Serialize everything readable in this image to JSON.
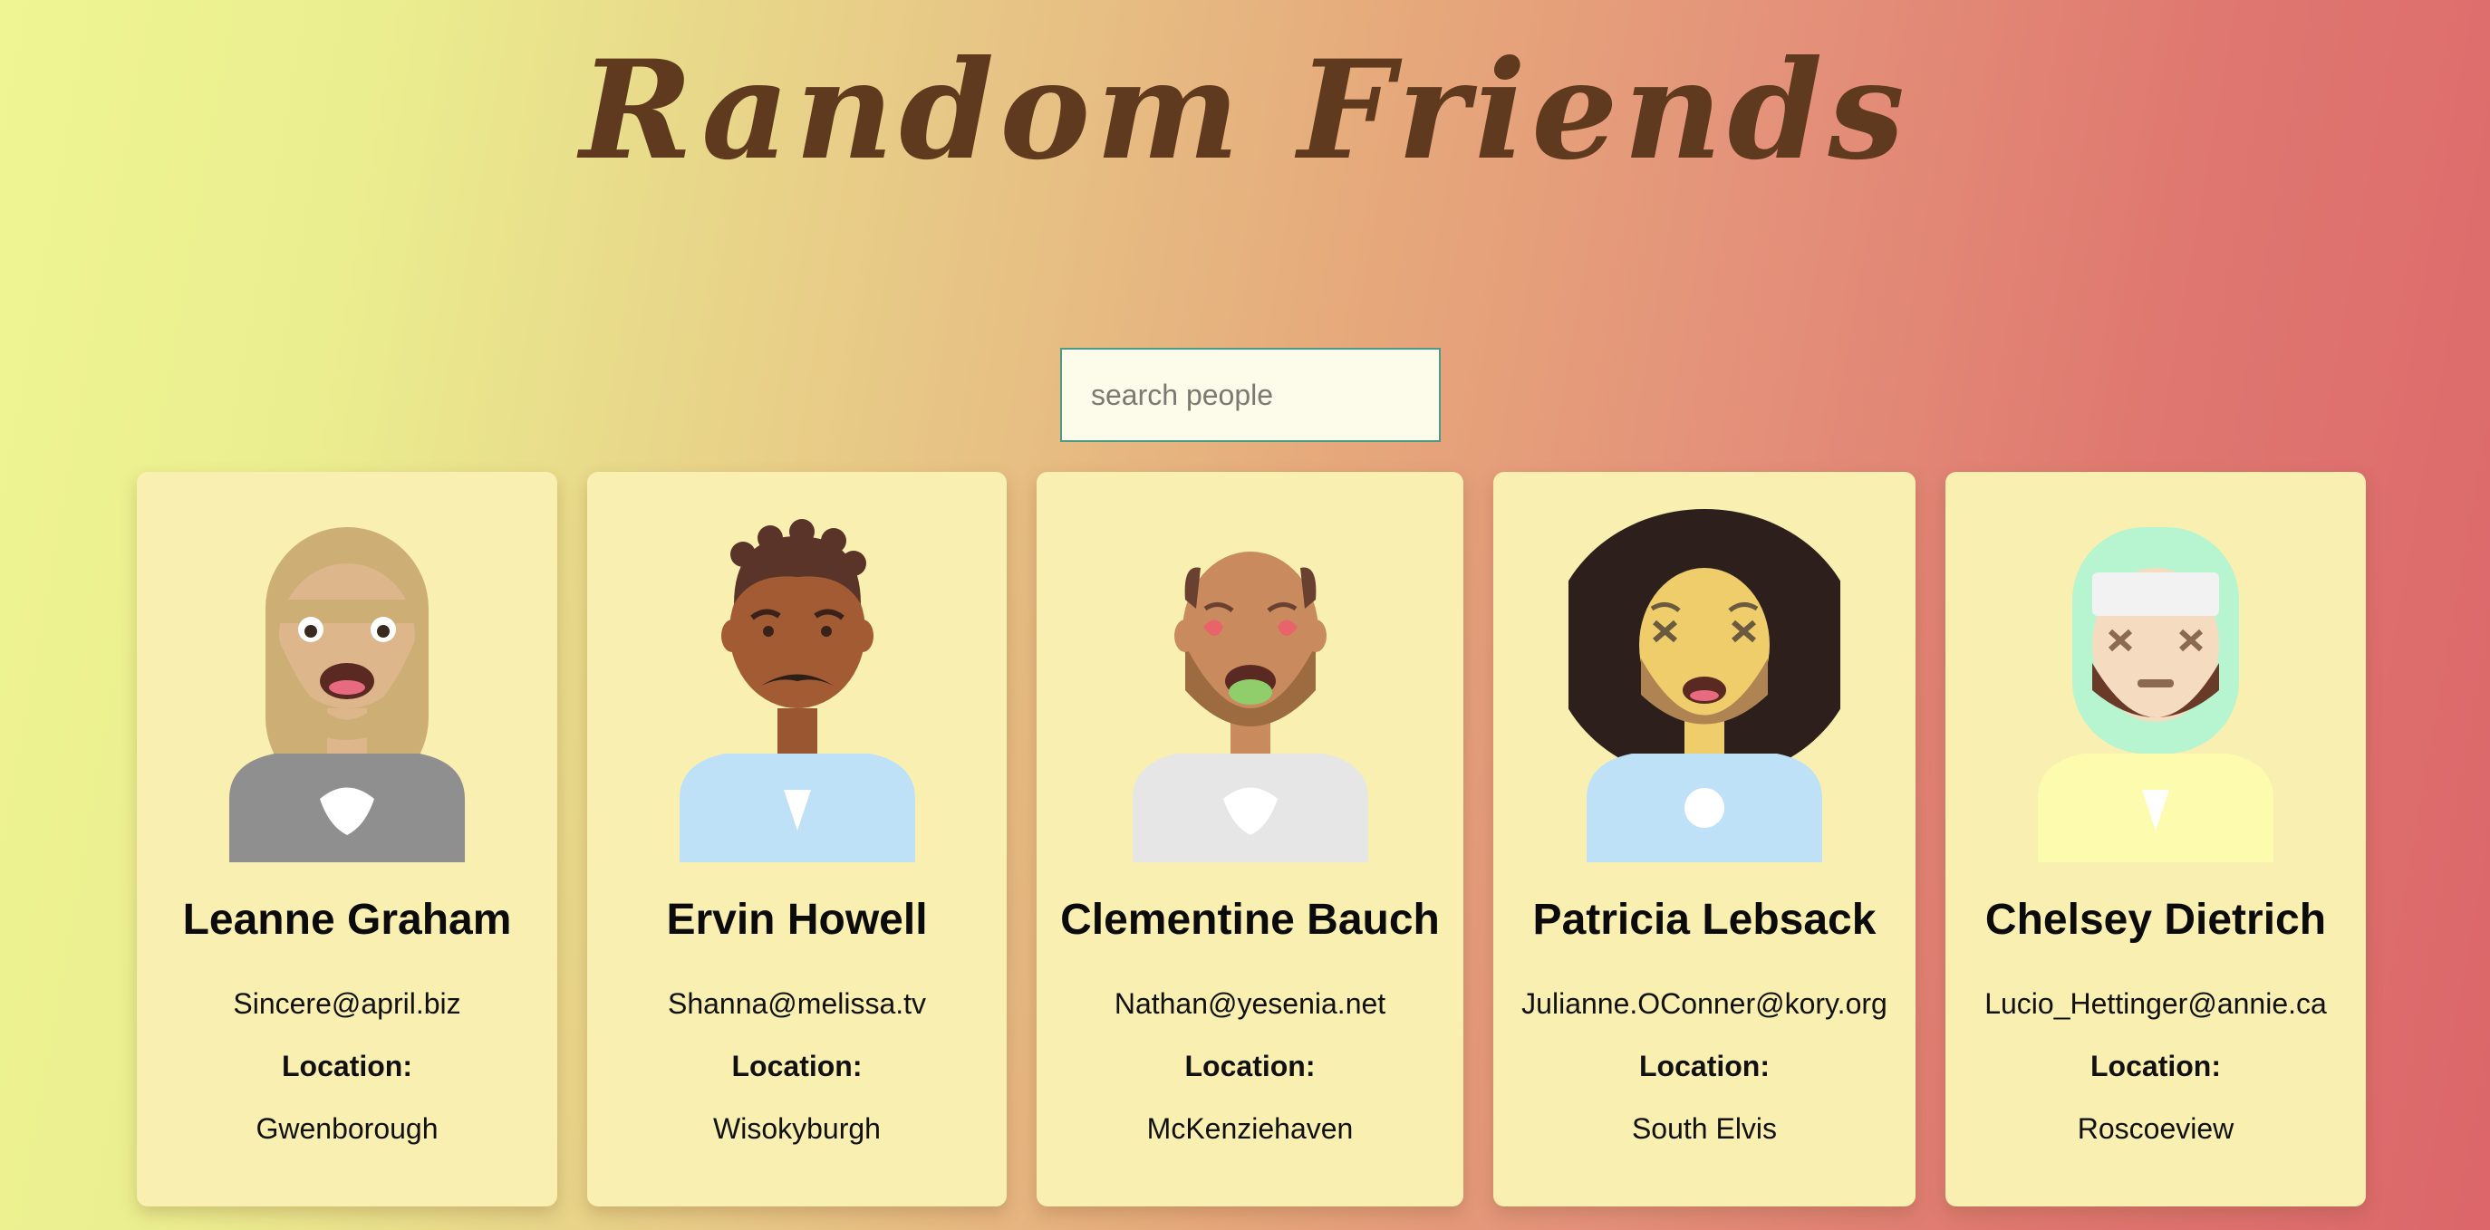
{
  "header": {
    "title": "Random Friends"
  },
  "search": {
    "placeholder": "search people"
  },
  "friends": [
    {
      "name": "Leanne Graham",
      "email": "Sincere@april.biz",
      "location_label": "Location:",
      "location": "Gwenborough"
    },
    {
      "name": "Ervin Howell",
      "email": "Shanna@melissa.tv",
      "location_label": "Location:",
      "location": "Wisokyburgh"
    },
    {
      "name": "Clementine Bauch",
      "email": "Nathan@yesenia.net",
      "location_label": "Location:",
      "location": "McKenziehaven"
    },
    {
      "name": "Patricia Lebsack",
      "email": "Julianne.OConner@kory.org",
      "location_label": "Location:",
      "location": "South Elvis"
    },
    {
      "name": "Chelsey Dietrich",
      "email": "Lucio_Hettinger@annie.ca",
      "location_label": "Location:",
      "location": "Roscoeview"
    }
  ],
  "colors": {
    "card_background": "#f9efb0",
    "title": "#5f3a1e",
    "search_border": "#4f9a86"
  }
}
